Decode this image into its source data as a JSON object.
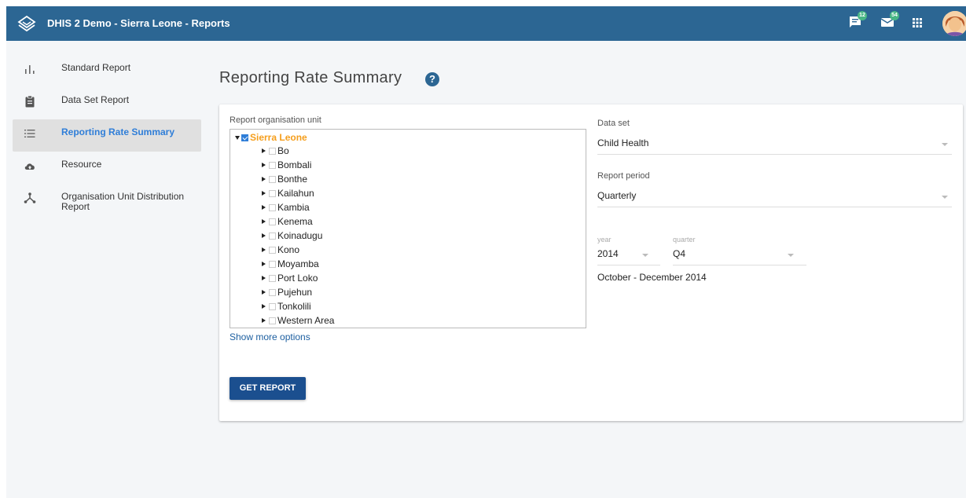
{
  "header": {
    "title": "DHIS 2 Demo - Sierra Leone - Reports",
    "messages_count": "12",
    "mail_count": "54",
    "colors": {
      "bar": "#2c6693",
      "badge": "#48b685"
    }
  },
  "sidebar": {
    "items": [
      {
        "label": "Standard Report",
        "icon": "bar-chart-icon"
      },
      {
        "label": "Data Set Report",
        "icon": "clipboard-icon"
      },
      {
        "label": "Reporting Rate Summary",
        "icon": "list-icon",
        "active": true
      },
      {
        "label": "Resource",
        "icon": "cloud-upload-icon"
      },
      {
        "label": "Organisation Unit Distribution Report",
        "icon": "hierarchy-icon"
      }
    ]
  },
  "main": {
    "title": "Reporting Rate Summary",
    "help": "?",
    "org_unit": {
      "label": "Report organisation unit",
      "root": "Sierra Leone",
      "children": [
        "Bo",
        "Bombali",
        "Bonthe",
        "Kailahun",
        "Kambia",
        "Kenema",
        "Koinadugu",
        "Kono",
        "Moyamba",
        "Port Loko",
        "Pujehun",
        "Tonkolili",
        "Western Area"
      ]
    },
    "more_options": "Show more options",
    "get_report": "GET REPORT",
    "data_set": {
      "label": "Data set",
      "value": "Child Health"
    },
    "report_period": {
      "label": "Report period",
      "value": "Quarterly"
    },
    "year": {
      "label": "year",
      "value": "2014"
    },
    "quarter": {
      "label": "quarter",
      "value": "Q4"
    },
    "period_text": "October - December 2014"
  }
}
